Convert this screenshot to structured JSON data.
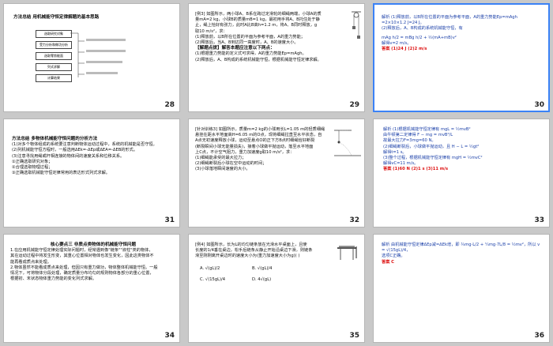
{
  "slides": [
    {
      "page": "28",
      "title": "方法总结  用机械能守恒定律解题的基本思路",
      "flow": [
        "选取研究对象",
        "受力分析和做功分析",
        "选取零势能面",
        "列式求解",
        "计算结果"
      ]
    },
    {
      "page": "29",
      "lines": [
        "[例3] 如图所示，两小球A、B系在跨过定滑轮的细绳两端，小球A的质",
        "量mA=2 kg，小球B的质量mB=1 kg，最初用手将A、B托住处于静",
        "止，绳上恰好有张力，此时A比B高h=1.2 m，将A、B同时释放，g",
        "取10 m/s²，求：",
        "(1)释放前，以B所在位置的平面为参考平面，A的重力势能；",
        "(2)释放后，当A、B到达同一高度时，A、B的速度大小。",
        "【解题点拨】解答本题应注意以下两点：",
        "(1)根据重力势能的定义式可求得，A的重力势能Ep=mAgh。",
        "(2)释放后，A、B构成的系统机械能守恒，根据机械能守恒定律求解。"
      ]
    },
    {
      "page": "30",
      "lines": [
        "解析  (1)释放前，以B所在位置的平面为参考平面，A的重力势能Ep=mAgh",
        "=2×10×1.2 J=24 J。",
        "(2)释放后，A、B构成的系统机械能守恒，有",
        "mAg h/2 = mBg h/2 + ½(mA+mB)v²",
        "解得v=2 m/s。",
        "答案  (1)24 J  (2)2 m/s"
      ]
    },
    {
      "page": "31",
      "lines": [
        "方法总结  多物体机械能守恒问题的分析方法",
        "(1)对多个物体组成的系统要注意判断物体运动过程中，系统的机械能是否守恒。",
        "(2)列机械能守恒方程时，一般选用ΔEk=-ΔEp或ΔEA=-ΔEB的形式。",
        "(3)注意寻找用绳或杆相连接的物体间的速度关系和位移关系。",
        "①正确选取研究对象；",
        "②合理选取物理过程；",
        "③正确选取机械能守恒定律常用的表达形式列式求解。"
      ]
    },
    {
      "page": "32",
      "lines": [
        "[针对训练3] 如图所示，质量m=2 kg的小球用长L=1.05 m的轻质细绳",
        "悬挂在距水平地面高H=6.05 m的O点，现将细绳拉直至水平状态，自",
        "A点无初速度释放小球，运动至悬点O的正下方B点时细绳恰好断裂",
        "(断裂瞬间小球无能量损失)，接着小球做平抛运动，落至水平地面",
        "上C点，不计空气阻力，重力加速度g取10 m/s²，求：",
        "(1)细绳能承受的最大拉力；",
        "(2)细绳断裂后小球在空中运动的时间；",
        "(3)小球落地瞬间速度的大小。"
      ]
    },
    {
      "page": "33",
      "lines": [
        "解析  (1)根据机械能守恒定律有 mgL = ½mvB²",
        "由牛顿第二定律得 F − mg = mvB²/L",
        "故最大拉力F=3mg=60 N。",
        "(2)细绳断裂后，小球做平抛运动，且 H − L = ½gt²",
        "解得t=1 s。",
        "(3)整个过程，根据机械能守恒定律有 mgH = ½mvC²",
        "解得vC=11 m/s。",
        "答案  (1)60 N  (2)1 s  (3)11 m/s"
      ]
    },
    {
      "page": "34",
      "lines": [
        "核心要点三  非质点类物体的机械能守恒问题",
        "1.在应用机械能守恒定律处理实际问题时，经常遇到像\"链条\"\"液柱\"类的物体，",
        "其在运动过程中将发生形变，其重心位置相对物体也发生变化，因此这类物体不",
        "能再看成质点来处理。",
        "2.物体虽然不能看成质点来处理，但因只有重力做功，物体整体机械能守恒。一般",
        "情况下，可将物体分段处理，确定质量分布均匀的规则物体各部分的重心位置，",
        "根据初、末状态物体重力势能的变化列式求解。"
      ]
    },
    {
      "page": "35",
      "lines": [
        "[例4] 如图所示，长为L的均匀链条放在光滑水平桌面上，且使",
        "长度的1/4垂在桌边，松手后链条从静止开始沿桌边下滑，则链条",
        "滑至刚刚离开桌边时的速度大小为(重力加速度大小为g)(      )"
      ],
      "options": [
        "A. √(gL)/2",
        "B. √(gL)/4",
        "C. √(15gL)/4",
        "D. 4√(gL)"
      ]
    },
    {
      "page": "36",
      "lines": [
        "解析  由机械能守恒定律ΔEp减=ΔEk增，即 ¾mg·L/2 + ¼mg·7L/8 = ½mv²，所以 v = √(15gL)/4，",
        "选项C正确。",
        "答案  C"
      ]
    }
  ]
}
